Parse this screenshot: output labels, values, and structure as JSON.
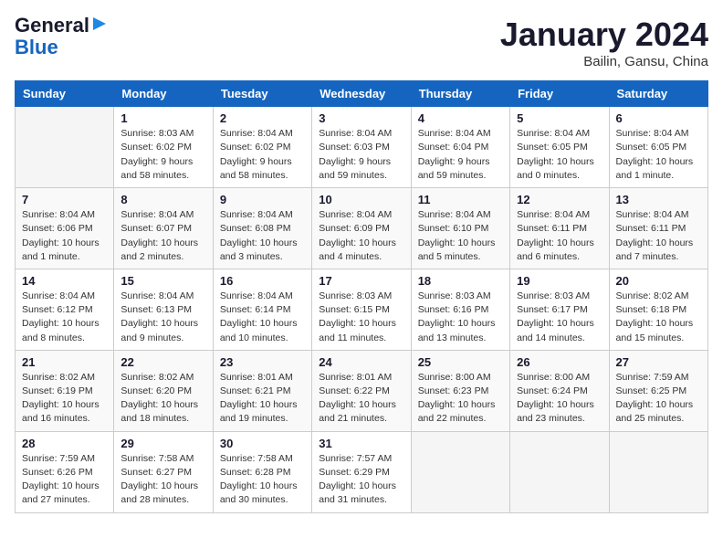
{
  "header": {
    "logo_line1": "General",
    "logo_line2": "Blue",
    "title": "January 2024",
    "subtitle": "Bailin, Gansu, China"
  },
  "weekdays": [
    "Sunday",
    "Monday",
    "Tuesday",
    "Wednesday",
    "Thursday",
    "Friday",
    "Saturday"
  ],
  "weeks": [
    [
      {
        "day": "",
        "info": ""
      },
      {
        "day": "1",
        "info": "Sunrise: 8:03 AM\nSunset: 6:02 PM\nDaylight: 9 hours\nand 58 minutes."
      },
      {
        "day": "2",
        "info": "Sunrise: 8:04 AM\nSunset: 6:02 PM\nDaylight: 9 hours\nand 58 minutes."
      },
      {
        "day": "3",
        "info": "Sunrise: 8:04 AM\nSunset: 6:03 PM\nDaylight: 9 hours\nand 59 minutes."
      },
      {
        "day": "4",
        "info": "Sunrise: 8:04 AM\nSunset: 6:04 PM\nDaylight: 9 hours\nand 59 minutes."
      },
      {
        "day": "5",
        "info": "Sunrise: 8:04 AM\nSunset: 6:05 PM\nDaylight: 10 hours\nand 0 minutes."
      },
      {
        "day": "6",
        "info": "Sunrise: 8:04 AM\nSunset: 6:05 PM\nDaylight: 10 hours\nand 1 minute."
      }
    ],
    [
      {
        "day": "7",
        "info": "Sunrise: 8:04 AM\nSunset: 6:06 PM\nDaylight: 10 hours\nand 1 minute."
      },
      {
        "day": "8",
        "info": "Sunrise: 8:04 AM\nSunset: 6:07 PM\nDaylight: 10 hours\nand 2 minutes."
      },
      {
        "day": "9",
        "info": "Sunrise: 8:04 AM\nSunset: 6:08 PM\nDaylight: 10 hours\nand 3 minutes."
      },
      {
        "day": "10",
        "info": "Sunrise: 8:04 AM\nSunset: 6:09 PM\nDaylight: 10 hours\nand 4 minutes."
      },
      {
        "day": "11",
        "info": "Sunrise: 8:04 AM\nSunset: 6:10 PM\nDaylight: 10 hours\nand 5 minutes."
      },
      {
        "day": "12",
        "info": "Sunrise: 8:04 AM\nSunset: 6:11 PM\nDaylight: 10 hours\nand 6 minutes."
      },
      {
        "day": "13",
        "info": "Sunrise: 8:04 AM\nSunset: 6:11 PM\nDaylight: 10 hours\nand 7 minutes."
      }
    ],
    [
      {
        "day": "14",
        "info": "Sunrise: 8:04 AM\nSunset: 6:12 PM\nDaylight: 10 hours\nand 8 minutes."
      },
      {
        "day": "15",
        "info": "Sunrise: 8:04 AM\nSunset: 6:13 PM\nDaylight: 10 hours\nand 9 minutes."
      },
      {
        "day": "16",
        "info": "Sunrise: 8:04 AM\nSunset: 6:14 PM\nDaylight: 10 hours\nand 10 minutes."
      },
      {
        "day": "17",
        "info": "Sunrise: 8:03 AM\nSunset: 6:15 PM\nDaylight: 10 hours\nand 11 minutes."
      },
      {
        "day": "18",
        "info": "Sunrise: 8:03 AM\nSunset: 6:16 PM\nDaylight: 10 hours\nand 13 minutes."
      },
      {
        "day": "19",
        "info": "Sunrise: 8:03 AM\nSunset: 6:17 PM\nDaylight: 10 hours\nand 14 minutes."
      },
      {
        "day": "20",
        "info": "Sunrise: 8:02 AM\nSunset: 6:18 PM\nDaylight: 10 hours\nand 15 minutes."
      }
    ],
    [
      {
        "day": "21",
        "info": "Sunrise: 8:02 AM\nSunset: 6:19 PM\nDaylight: 10 hours\nand 16 minutes."
      },
      {
        "day": "22",
        "info": "Sunrise: 8:02 AM\nSunset: 6:20 PM\nDaylight: 10 hours\nand 18 minutes."
      },
      {
        "day": "23",
        "info": "Sunrise: 8:01 AM\nSunset: 6:21 PM\nDaylight: 10 hours\nand 19 minutes."
      },
      {
        "day": "24",
        "info": "Sunrise: 8:01 AM\nSunset: 6:22 PM\nDaylight: 10 hours\nand 21 minutes."
      },
      {
        "day": "25",
        "info": "Sunrise: 8:00 AM\nSunset: 6:23 PM\nDaylight: 10 hours\nand 22 minutes."
      },
      {
        "day": "26",
        "info": "Sunrise: 8:00 AM\nSunset: 6:24 PM\nDaylight: 10 hours\nand 23 minutes."
      },
      {
        "day": "27",
        "info": "Sunrise: 7:59 AM\nSunset: 6:25 PM\nDaylight: 10 hours\nand 25 minutes."
      }
    ],
    [
      {
        "day": "28",
        "info": "Sunrise: 7:59 AM\nSunset: 6:26 PM\nDaylight: 10 hours\nand 27 minutes."
      },
      {
        "day": "29",
        "info": "Sunrise: 7:58 AM\nSunset: 6:27 PM\nDaylight: 10 hours\nand 28 minutes."
      },
      {
        "day": "30",
        "info": "Sunrise: 7:58 AM\nSunset: 6:28 PM\nDaylight: 10 hours\nand 30 minutes."
      },
      {
        "day": "31",
        "info": "Sunrise: 7:57 AM\nSunset: 6:29 PM\nDaylight: 10 hours\nand 31 minutes."
      },
      {
        "day": "",
        "info": ""
      },
      {
        "day": "",
        "info": ""
      },
      {
        "day": "",
        "info": ""
      }
    ]
  ]
}
